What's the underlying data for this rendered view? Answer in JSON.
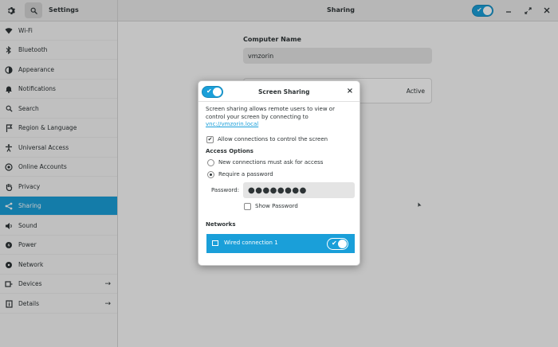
{
  "header": {
    "app_title": "Settings",
    "panel_title": "Sharing",
    "window_controls": [
      "minimize-icon",
      "restore-icon",
      "close-icon"
    ]
  },
  "sidebar": {
    "items": [
      {
        "label": "Wi-Fi",
        "icon": "wifi-icon"
      },
      {
        "label": "Bluetooth",
        "icon": "bluetooth-icon"
      },
      {
        "label": "Appearance",
        "icon": "appearance-icon"
      },
      {
        "label": "Notifications",
        "icon": "bell-icon"
      },
      {
        "label": "Search",
        "icon": "search-icon"
      },
      {
        "label": "Region & Language",
        "icon": "flag-icon"
      },
      {
        "label": "Universal Access",
        "icon": "accessibility-icon"
      },
      {
        "label": "Online Accounts",
        "icon": "online-accounts-icon"
      },
      {
        "label": "Privacy",
        "icon": "hand-icon"
      },
      {
        "label": "Sharing",
        "icon": "share-icon",
        "active": true
      },
      {
        "label": "Sound",
        "icon": "speaker-icon"
      },
      {
        "label": "Power",
        "icon": "power-icon"
      },
      {
        "label": "Network",
        "icon": "network-icon"
      },
      {
        "label": "Devices",
        "icon": "devices-icon",
        "has_arrow": true
      },
      {
        "label": "Details",
        "icon": "details-icon",
        "has_arrow": true
      }
    ]
  },
  "main": {
    "computer_name_label": "Computer Name",
    "computer_name_value": "vmzorin",
    "screen_sharing_status": "Active"
  },
  "dialog": {
    "title": "Screen Sharing",
    "close_glyph": "×",
    "description_prefix": "Screen sharing allows remote users to view or control your screen by connecting to ",
    "description_link": "vnc://vmzorin.local",
    "allow_control_label": "Allow connections to control the screen",
    "allow_control_checked": true,
    "access_options_label": "Access Options",
    "options": [
      {
        "label": "New connections must ask for access",
        "selected": false
      },
      {
        "label": "Require a password",
        "selected": true
      }
    ],
    "password_label": "Password:",
    "password_value": "●●●●●●●●",
    "show_password_label": "Show Password",
    "show_password_checked": false,
    "networks_label": "Networks",
    "network_name": "Wired connection 1",
    "network_enabled": true
  },
  "colors": {
    "accent": "#1a9fd9",
    "headerbar": "#ebebeb",
    "sidebar": "#f6f6f6"
  }
}
